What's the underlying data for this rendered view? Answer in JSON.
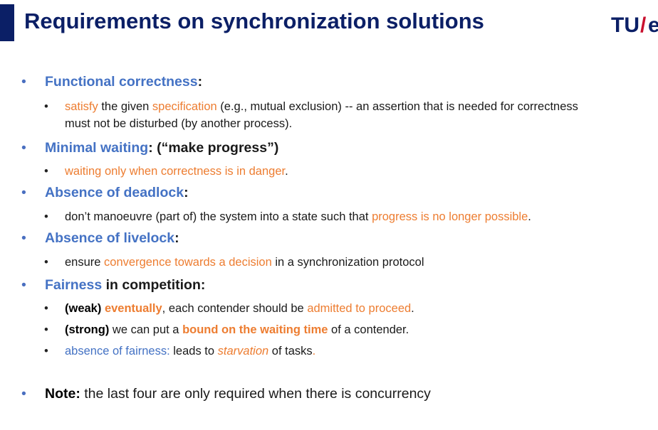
{
  "slide": {
    "title": "Requirements on synchronization solutions",
    "logo_text": "TU/e",
    "colors": {
      "title": "#0b1f66",
      "heading": "#4472c4",
      "highlight": "#ed7d31",
      "logo": "#c8102e"
    }
  },
  "items": {
    "functional": {
      "heading": "Functional correctness",
      "heading_suffix": ":",
      "sub1": {
        "a": "satisfy",
        "b": " the given ",
        "c": "specification",
        "d": " (e.g., mutual exclusion) -- an assertion that is needed for correctness must not be disturbed (by another process)."
      }
    },
    "minimal": {
      "heading": "Minimal waiting",
      "heading_suffix": ": (“make progress”)",
      "sub1": {
        "a": "waiting only when correctness is in danger",
        "b": "."
      }
    },
    "deadlock": {
      "heading": "Absence of deadlock",
      "heading_suffix": ":",
      "sub1": {
        "a": "don’t manoeuvre (part of) the system into a state such that ",
        "b": "progress is no longer possible",
        "c": "."
      }
    },
    "livelock": {
      "heading": "Absence of livelock",
      "heading_suffix": ":",
      "sub1": {
        "a": "ensure ",
        "b": "convergence towards a decision",
        "c": " in a synchronization protocol"
      }
    },
    "fairness": {
      "heading": "Fairness",
      "heading_suffix": " in competition:",
      "sub1": {
        "a": "(weak)",
        "b": " ",
        "c": "eventually",
        "d": ", each contender should be ",
        "e": "admitted to proceed",
        "f": "."
      },
      "sub2": {
        "a": "(strong)",
        "b": " we can put a ",
        "c": "bound on the waiting time",
        "d": " of a contender."
      },
      "sub3": {
        "a": "absence of fairness:",
        "b": " leads to ",
        "c": "starvation",
        "d": " of tasks",
        "e": "."
      }
    },
    "note": {
      "label": "Note:",
      "text": " the last four are only required when there is concurrency"
    }
  }
}
